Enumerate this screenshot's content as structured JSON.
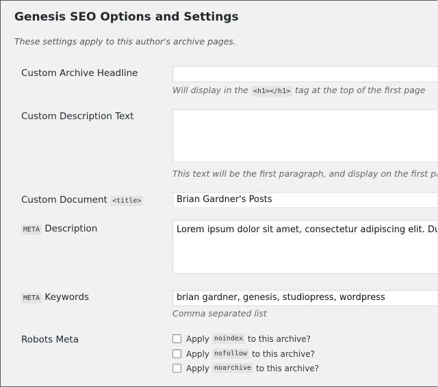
{
  "section": {
    "title": "Genesis SEO Options and Settings",
    "subtitle": "These settings apply to this author's archive pages."
  },
  "fields": {
    "headline": {
      "label": "Custom Archive Headline",
      "value": "",
      "desc_before": "Will display in the",
      "desc_code": "<h1></h1>",
      "desc_after": "tag at the top of the first page"
    },
    "description_text": {
      "label": "Custom Description Text",
      "value": "",
      "desc": "This text will be the first paragraph, and display on the first page"
    },
    "doc_title": {
      "label": "Custom Document",
      "label_code": "<title>",
      "value": "Brian Gardner's Posts"
    },
    "meta_description": {
      "label_code": "META",
      "label": "Description",
      "value": "Lorem ipsum dolor sit amet, consectetur adipiscing elit. Du"
    },
    "meta_keywords": {
      "label_code": "META",
      "label": "Keywords",
      "value": "brian gardner, genesis, studiopress, wordpress",
      "desc": "Comma separated list"
    },
    "robots": {
      "label": "Robots Meta",
      "options": [
        {
          "prefix": "Apply",
          "code": "noindex",
          "suffix": "to this archive?",
          "checked": false
        },
        {
          "prefix": "Apply",
          "code": "nofollow",
          "suffix": "to this archive?",
          "checked": false
        },
        {
          "prefix": "Apply",
          "code": "noarchive",
          "suffix": "to this archive?",
          "checked": false
        }
      ]
    }
  }
}
